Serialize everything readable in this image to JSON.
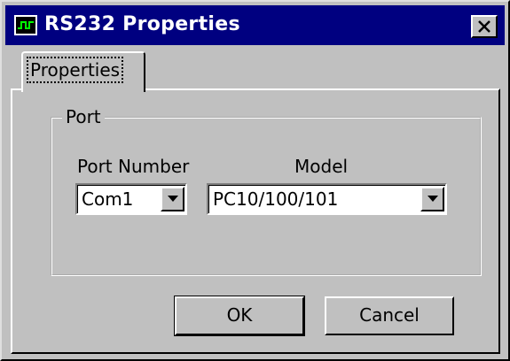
{
  "window": {
    "title": "RS232 Properties",
    "app_icon": "serial-waveform-icon",
    "close_icon": "close-icon"
  },
  "tabs": [
    {
      "label": "Properties",
      "selected": true
    }
  ],
  "port_group": {
    "legend": "Port",
    "port_number": {
      "label": "Port Number",
      "value": "Com1"
    },
    "model": {
      "label": "Model",
      "value": "PC10/100/101"
    }
  },
  "buttons": {
    "ok_label": "OK",
    "cancel_label": "Cancel"
  },
  "colors": {
    "titlebar": "#000080",
    "face": "#c0c0c0",
    "title_text": "#ffffff"
  }
}
